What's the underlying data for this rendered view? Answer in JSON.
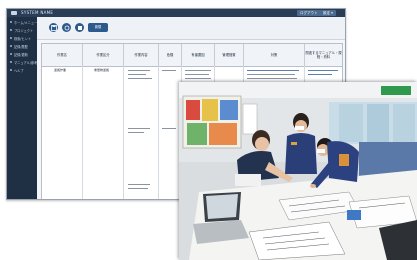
{
  "app": {
    "title": "SYSTEM NAME",
    "header_buttons": [
      "ログアウト",
      "設定 ▾"
    ],
    "toolbar_button_label": "新規",
    "sidebar_items": [
      "ホーム/メニュー",
      "プロジェクト",
      "検索/ヒント",
      "記録/履歴",
      "記録/更新",
      "マニュアル/参考",
      "ヘルプ"
    ]
  },
  "table": {
    "headers": [
      "作業名",
      "作業区分",
      "作業内容",
      "危険",
      "有害要因",
      "管理措置",
      "対策",
      "関連するマニュアル・規程・資料"
    ],
    "row_cells": [
      {
        "col": 0,
        "text": "運搬作業"
      },
      {
        "col": 1,
        "text": "重量物運搬"
      }
    ]
  },
  "photo": {
    "description": "Workers gathered around a table reviewing documents in an office"
  }
}
